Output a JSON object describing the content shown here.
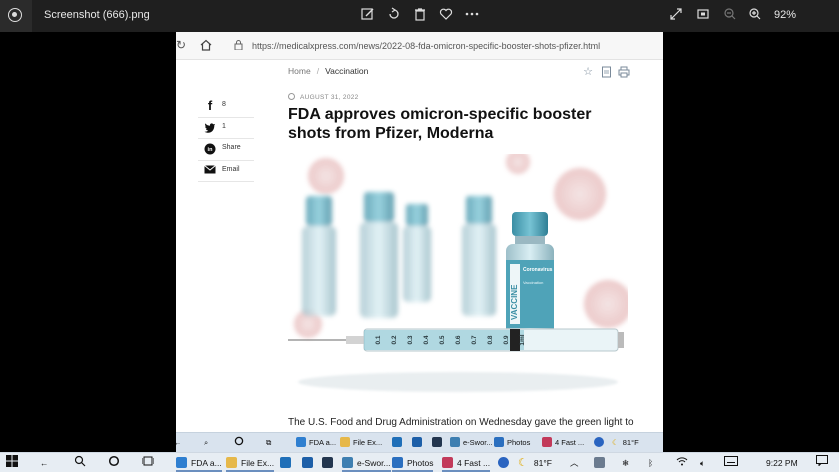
{
  "viewer": {
    "filename": "Screenshot (666).png",
    "zoom": "92%",
    "toolbar_icons": [
      "edit-icon",
      "rotate-icon",
      "delete-icon",
      "favorite-icon",
      "more-icon"
    ],
    "right_icons": [
      "expand-icon",
      "fit-icon",
      "zoom-out-icon",
      "zoom-in-icon"
    ]
  },
  "browser": {
    "url": "https://medicalxpress.com/news/2022-08-fda-omicron-specific-booster-shots-pfizer.html"
  },
  "article": {
    "breadcrumb_home": "Home",
    "breadcrumb_sep": "/",
    "breadcrumb_category": "Vaccination",
    "date": "AUGUST 31, 2022",
    "headline": "FDA approves omicron-specific booster shots from Pfizer, Moderna",
    "lede": "The U.S. Food and Drug Administration on Wednesday gave the green light to",
    "share": [
      {
        "icon": "f",
        "label": "8"
      },
      {
        "icon": "t",
        "label": "1"
      },
      {
        "icon": "in",
        "label": "Share"
      },
      {
        "icon": "mail",
        "label": "Email"
      }
    ],
    "image_text": {
      "vial_label": "VACCINE",
      "vial_title": "Coronavirus COVID-19",
      "vial_sub": "Vaccination",
      "syringe_marks": [
        "0.1",
        "0.2",
        "0.3",
        "0.4",
        "0.5",
        "0.6",
        "0.7",
        "0.8",
        "0.9",
        "1ml"
      ]
    }
  },
  "inner_taskbar": {
    "items": [
      "FDA a...",
      "File Ex...",
      "e-Swor...",
      "Photos",
      "4 Fast ..."
    ],
    "temp": "81°F"
  },
  "taskbar": {
    "items": [
      "FDA a...",
      "File Ex...",
      "e-Swor...",
      "Photos",
      "4 Fast ..."
    ],
    "temp": "81°F",
    "time": "9:22 PM"
  },
  "colors": {
    "vial_teal": "#4fa3b8",
    "viewer_bg": "#1f1f1f",
    "taskbar_bg": "#e7edf3"
  }
}
